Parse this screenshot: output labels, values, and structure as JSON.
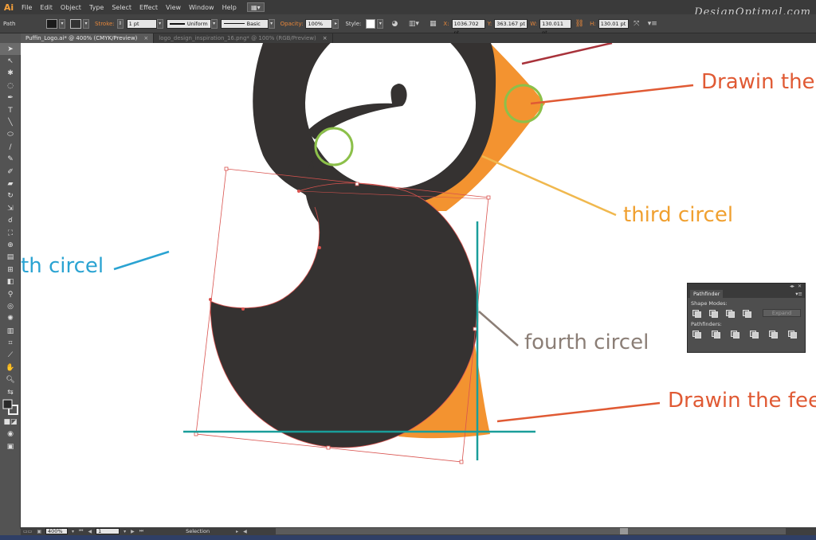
{
  "menubar": {
    "app_logo": "Ai",
    "items": [
      "File",
      "Edit",
      "Object",
      "Type",
      "Select",
      "Effect",
      "View",
      "Window",
      "Help"
    ],
    "watermark": "DesignOptimal.com"
  },
  "controlbar": {
    "selection_label": "Path",
    "stroke_label": "Stroke:",
    "stroke_weight": "1 pt",
    "stroke_profile": "Uniform",
    "brush": "Basic",
    "opacity_label": "Opacity:",
    "opacity_value": "100%",
    "style_label": "Style:",
    "x_label": "X:",
    "x_value": "1036.702 pt",
    "y_label": "Y:",
    "y_value": "363.167 pt",
    "w_label": "W:",
    "w_value": "130.011 pt",
    "h_label": "H:",
    "h_value": "130.01 pt"
  },
  "tabs": [
    {
      "label": "Puffin_Logo.ai* @ 400% (CMYK/Preview)",
      "close": "×",
      "active": true
    },
    {
      "label": "logo_design_inspiration_16.png* @ 100% (RGB/Preview)",
      "close": "×",
      "active": false
    }
  ],
  "annotations": {
    "a1": "Drawin the",
    "a2": "third  circel",
    "a3": "th circel",
    "a4": "fourth circel",
    "a5": "Drawin the fee"
  },
  "pathfinder": {
    "title": "Pathfinder",
    "shape_modes_label": "Shape Modes:",
    "expand_label": "Expand",
    "pathfinders_label": "Pathfinders:"
  },
  "statusbar": {
    "zoom": "400%",
    "artboard": "1",
    "tool_label": "Selection"
  },
  "colors": {
    "shape_dark": "#353231",
    "orange": "#f39330",
    "green_circle": "#8cc04a",
    "teal_guide": "#1a9e9a",
    "red_label": "#e05a34",
    "amber_label": "#f0a030",
    "blue_label": "#2aa3d2",
    "gray_label": "#8b7e76"
  }
}
